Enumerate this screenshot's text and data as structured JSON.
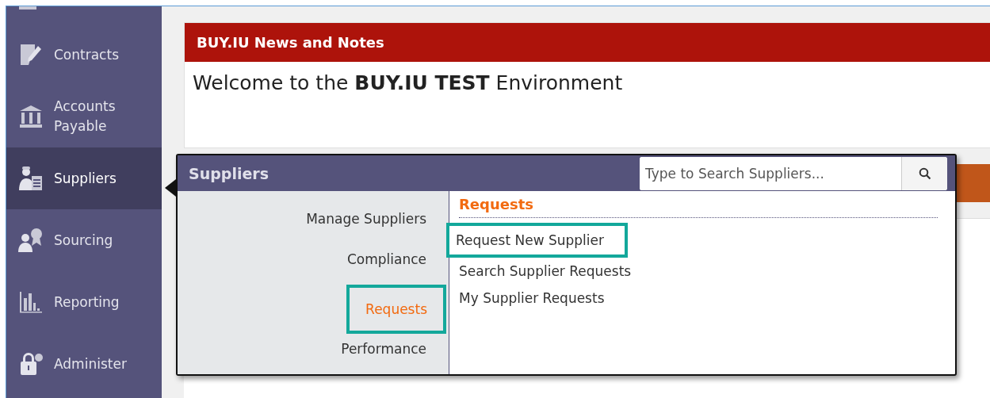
{
  "sidebar": {
    "items": [
      {
        "label": "Contracts",
        "selected": false
      },
      {
        "label": "Accounts Payable",
        "selected": false
      },
      {
        "label": "Suppliers",
        "selected": true
      },
      {
        "label": "Sourcing",
        "selected": false
      },
      {
        "label": "Reporting",
        "selected": false
      },
      {
        "label": "Administer",
        "selected": false
      }
    ]
  },
  "news": {
    "title": "BUY.IU News and Notes",
    "message": "Welcome to the **BUY.IU TEST** Environment"
  },
  "flyout": {
    "title": "Suppliers",
    "search": {
      "placeholder": "Type to Search Suppliers..."
    },
    "menu": [
      {
        "label": "Manage Suppliers",
        "selected": false,
        "highlighted": false
      },
      {
        "label": "Compliance",
        "selected": false,
        "highlighted": false
      },
      {
        "label": "Requests",
        "selected": true,
        "highlighted": true
      },
      {
        "label": "Performance",
        "selected": false,
        "highlighted": false
      }
    ],
    "section": {
      "title": "Requests",
      "links": [
        {
          "label": "Request New Supplier",
          "highlighted": true
        },
        {
          "label": "Search Supplier Requests",
          "highlighted": false
        },
        {
          "label": "My Supplier Requests",
          "highlighted": false
        }
      ]
    }
  }
}
